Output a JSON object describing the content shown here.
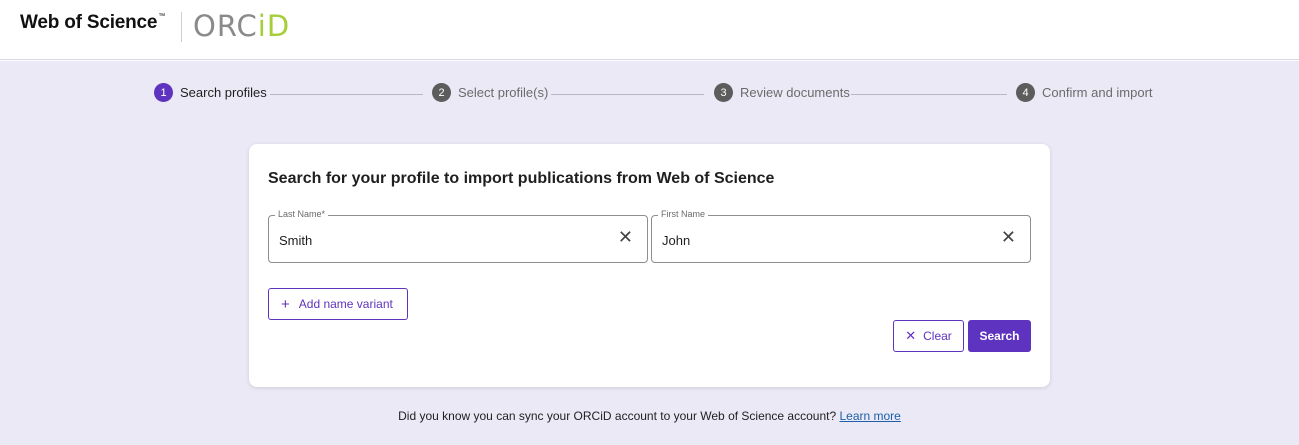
{
  "header": {
    "brand": "Web of Science",
    "brand_tm": "™",
    "orcid_logo_prefix": "ORC",
    "orcid_logo_suffix": "iD"
  },
  "stepper": {
    "steps": [
      {
        "number": "1",
        "label": "Search profiles",
        "active": true
      },
      {
        "number": "2",
        "label": "Select profile(s)",
        "active": false
      },
      {
        "number": "3",
        "label": "Review documents",
        "active": false
      },
      {
        "number": "4",
        "label": "Confirm and import",
        "active": false
      }
    ]
  },
  "search_card": {
    "title": "Search for your profile to import publications from Web of Science",
    "last_name": {
      "label": "Last Name*",
      "value": "Smith",
      "clear_glyph": "✕"
    },
    "first_name": {
      "label": "First Name",
      "value": "John",
      "clear_glyph": "✕"
    },
    "add_variant": {
      "icon_glyph": "+",
      "label": "Add name variant"
    },
    "clear_button": {
      "icon_glyph": "✕",
      "label": "Clear"
    },
    "search_button": {
      "label": "Search"
    }
  },
  "footer": {
    "text": "Did you know you can sync your ORCiD account to your Web of Science account?",
    "link": "Learn more"
  },
  "colors": {
    "accent": "#5e33bf",
    "background": "#ebe9f6",
    "orcid_green": "#a6ce39",
    "link": "#1d5fa8"
  }
}
